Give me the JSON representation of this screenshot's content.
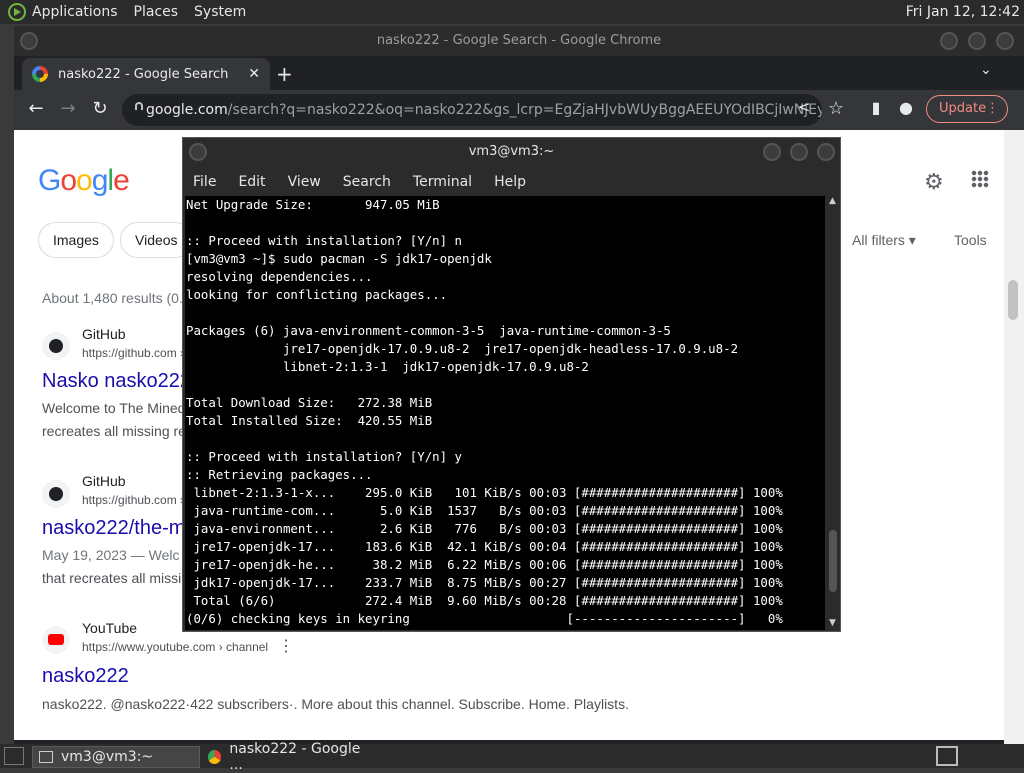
{
  "top_panel": {
    "menus": [
      "Applications",
      "Places",
      "System"
    ],
    "clock": "Fri Jan 12, 12:42"
  },
  "chrome": {
    "window_title": "nasko222 - Google Search - Google Chrome",
    "tab_title": "nasko222 - Google Search",
    "new_tab": "+",
    "url_host": "google.com",
    "url_path": "/search?q=nasko222&oq=nasko222&gs_lcrp=EgZjaHJvbWUyBggAEEUYOdIBCjIwNjEyaj...",
    "update_label": "Update"
  },
  "google": {
    "logo": "Google",
    "chips": [
      "Images",
      "Videos"
    ],
    "all_filters": "All filters",
    "tools": "Tools",
    "result_count": "About 1,480 results (0.",
    "results": [
      {
        "site": "GitHub",
        "url": "https://github.com ›",
        "title": "Nasko nasko222",
        "snippet1": "Welcome to The Mined",
        "snippet2": "recreates all missing re"
      },
      {
        "site": "GitHub",
        "url": "https://github.com ›",
        "title": "nasko222/the-m",
        "snippet1": "May 19, 2023 — Welc",
        "snippet2": "that recreates all missi"
      },
      {
        "site": "YouTube",
        "url": "https://www.youtube.com › channel",
        "title": "nasko222",
        "snippet1": "nasko222. @nasko222·422 subscribers·. More about this channel. Subscribe. Home. Playlists."
      }
    ]
  },
  "terminal": {
    "title": "vm3@vm3:~",
    "menus": [
      "File",
      "Edit",
      "View",
      "Search",
      "Terminal",
      "Help"
    ],
    "lines": [
      "Net Upgrade Size:       947.05 MiB",
      "",
      ":: Proceed with installation? [Y/n] n",
      "[vm3@vm3 ~]$ sudo pacman -S jdk17-openjdk",
      "resolving dependencies...",
      "looking for conflicting packages...",
      "",
      "Packages (6) java-environment-common-3-5  java-runtime-common-3-5",
      "             jre17-openjdk-17.0.9.u8-2  jre17-openjdk-headless-17.0.9.u8-2",
      "             libnet-2:1.3-1  jdk17-openjdk-17.0.9.u8-2",
      "",
      "Total Download Size:   272.38 MiB",
      "Total Installed Size:  420.55 MiB",
      "",
      ":: Proceed with installation? [Y/n] y",
      ":: Retrieving packages...",
      " libnet-2:1.3-1-x...    295.0 KiB   101 KiB/s 00:03 [#####################] 100%",
      " java-runtime-com...      5.0 KiB  1537   B/s 00:03 [#####################] 100%",
      " java-environment...      2.6 KiB   776   B/s 00:03 [#####################] 100%",
      " jre17-openjdk-17...    183.6 KiB  42.1 KiB/s 00:04 [#####################] 100%",
      " jre17-openjdk-he...     38.2 MiB  6.22 MiB/s 00:06 [#####################] 100%",
      " jdk17-openjdk-17...    233.7 MiB  8.75 MiB/s 00:27 [#####################] 100%",
      " Total (6/6)            272.4 MiB  9.60 MiB/s 00:28 [#####################] 100%",
      "(0/6) checking keys in keyring                     [----------------------]   0%"
    ]
  },
  "taskbar": {
    "items": [
      "vm3@vm3:~",
      "nasko222 - Google ..."
    ]
  }
}
